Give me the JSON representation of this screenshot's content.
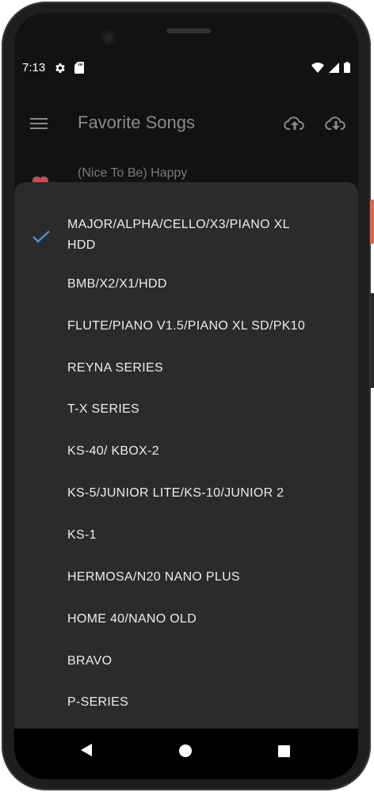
{
  "status_bar": {
    "time": "7:13"
  },
  "app_bar": {
    "title": "Favorite Songs"
  },
  "song_list": {
    "first_item": "(Nice To Be) Happy"
  },
  "menu": {
    "selected_index": 0,
    "items": [
      {
        "label_line1": "MAJOR/ALPHA/CELLO/X3/PIANO XL",
        "label_line2": "HDD"
      },
      {
        "label": "BMB/X2/X1/HDD"
      },
      {
        "label": "FLUTE/PIANO V1.5/PIANO XL SD/PK10"
      },
      {
        "label": "REYNA SERIES"
      },
      {
        "label": "T-X SERIES"
      },
      {
        "label": "KS-40/ KBOX-2"
      },
      {
        "label": "KS-5/JUNIOR LITE/KS-10/JUNIOR 2"
      },
      {
        "label": "KS-1"
      },
      {
        "label": "HERMOSA/N20 NANO PLUS"
      },
      {
        "label": "HOME 40/NANO OLD"
      },
      {
        "label": "BRAVO"
      },
      {
        "label": "P-SERIES"
      }
    ]
  },
  "colors": {
    "accent": "#4a90e2",
    "heart": "#d04a4a",
    "menu_bg": "#2b2b2c",
    "screen_bg": "#121212"
  }
}
